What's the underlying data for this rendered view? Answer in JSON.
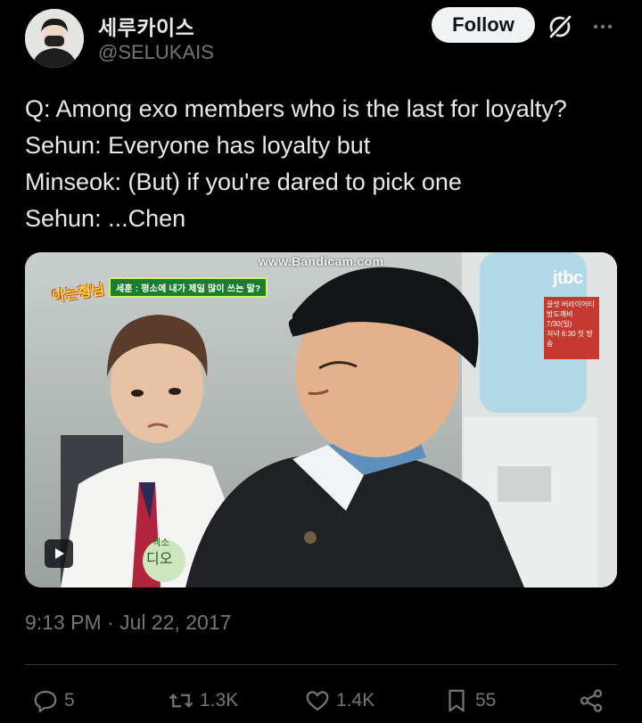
{
  "author": {
    "display_name": "세루카이스",
    "handle": "@SELUKAIS"
  },
  "header": {
    "follow_label": "Follow",
    "grok_icon": "grok-icon",
    "more_icon": "more-options-icon"
  },
  "tweet": {
    "lines": [
      "Q: Among exo members who is the last for loyalty?",
      "Sehun: Everyone has loyalty but",
      "Minseok: (But) if you're dared to pick one",
      "Sehun: ...Chen"
    ],
    "timestamp": "9:13 PM · Jul 22, 2017"
  },
  "media": {
    "watermark": "www.Bandicam.com",
    "broadcaster_logo": "jtbc",
    "show_logo": "아는형님",
    "caption": "세훈 : 평소에 내가 제일 많이 쓰는 말?",
    "side_panel": [
      "꿀맛 버라이어티",
      "방도깨비",
      "7/30(일)",
      "저녁 6:30 첫 방송"
    ],
    "name_tag_top": "엑소",
    "name_tag_bottom": "디오",
    "play_icon": "play-icon"
  },
  "actions": {
    "replies": "5",
    "reposts": "1.3K",
    "likes": "1.4K",
    "bookmarks": "55"
  },
  "colors": {
    "background": "#000000",
    "primary_text": "#e7e9ea",
    "secondary_text": "#71767b",
    "follow_button_bg": "#eff3f4"
  }
}
